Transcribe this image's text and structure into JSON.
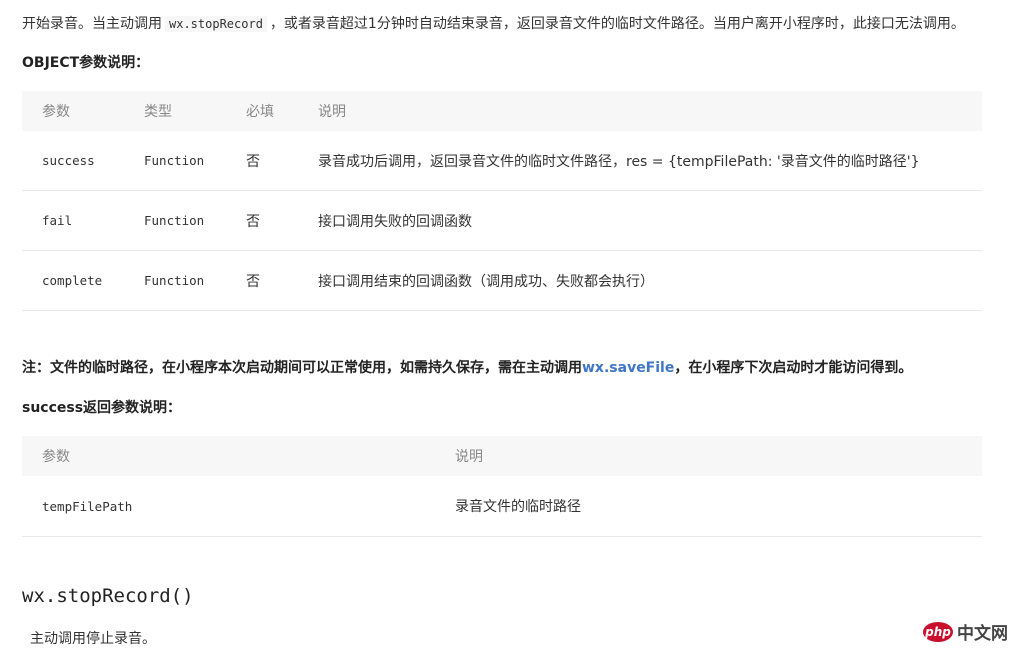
{
  "intro": {
    "before": "开始录音。当主动调用",
    "code": "wx.stopRecord",
    "after": "，或者录音超过1分钟时自动结束录音，返回录音文件的临时文件路径。当用户离开小程序时，此接口无法调用。"
  },
  "object_heading": "OBJECT参数说明：",
  "params_table": {
    "headers": [
      "参数",
      "类型",
      "必填",
      "说明"
    ],
    "rows": [
      {
        "name": "success",
        "type": "Function",
        "required": "否",
        "desc": "录音成功后调用，返回录音文件的临时文件路径，res = {tempFilePath: '录音文件的临时路径'}"
      },
      {
        "name": "fail",
        "type": "Function",
        "required": "否",
        "desc": "接口调用失败的回调函数"
      },
      {
        "name": "complete",
        "type": "Function",
        "required": "否",
        "desc": "接口调用结束的回调函数（调用成功、失败都会执行）"
      }
    ]
  },
  "note": {
    "before": "注：文件的临时路径，在小程序本次启动期间可以正常使用，如需持久保存，需在主动调用",
    "link": "wx.saveFile",
    "after": "，在小程序下次启动时才能访问得到。"
  },
  "success_heading": "success返回参数说明：",
  "return_table": {
    "headers": [
      "参数",
      "说明"
    ],
    "rows": [
      {
        "name": "tempFilePath",
        "desc": "录音文件的临时路径"
      }
    ]
  },
  "function_title": "wx.stopRecord()",
  "function_desc": "主动调用停止录音。",
  "watermark": {
    "badge": "php",
    "text": "中文网"
  }
}
